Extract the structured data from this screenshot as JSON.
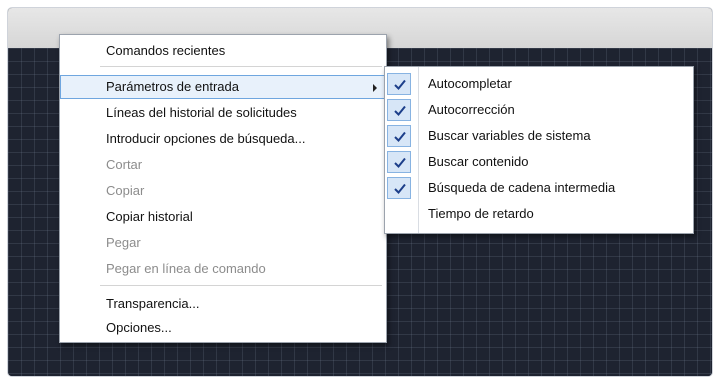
{
  "context_menu": {
    "items": [
      {
        "label": "Comandos recientes",
        "state": "enabled"
      },
      {
        "label": "Parámetros de entrada",
        "state": "active",
        "has_submenu": true
      },
      {
        "label": "Líneas del historial de solicitudes",
        "state": "enabled"
      },
      {
        "label": "Introducir opciones de búsqueda...",
        "state": "enabled"
      },
      {
        "label": "Cortar",
        "state": "disabled"
      },
      {
        "label": "Copiar",
        "state": "disabled"
      },
      {
        "label": "Copiar historial",
        "state": "enabled"
      },
      {
        "label": "Pegar",
        "state": "disabled"
      },
      {
        "label": "Pegar en línea de comando",
        "state": "disabled"
      },
      {
        "label": "Transparencia...",
        "state": "enabled"
      },
      {
        "label": "Opciones...",
        "state": "enabled"
      }
    ]
  },
  "submenu": {
    "items": [
      {
        "label": "Autocompletar",
        "checked": true
      },
      {
        "label": "Autocorrección",
        "checked": true
      },
      {
        "label": "Buscar variables de sistema",
        "checked": true
      },
      {
        "label": "Buscar contenido",
        "checked": true
      },
      {
        "label": "Búsqueda de cadena intermedia",
        "checked": true
      },
      {
        "label": "Tiempo de retardo",
        "checked": false
      }
    ]
  },
  "colors": {
    "canvas": "#1e2330",
    "highlight_fill": "#e8f1fb",
    "highlight_border": "#6fa6df",
    "check_fill": "#d7e6f7",
    "disabled_text": "#8c8c8c"
  },
  "icons": {
    "submenu_arrow": "chevron-right-icon",
    "check": "check-icon"
  }
}
